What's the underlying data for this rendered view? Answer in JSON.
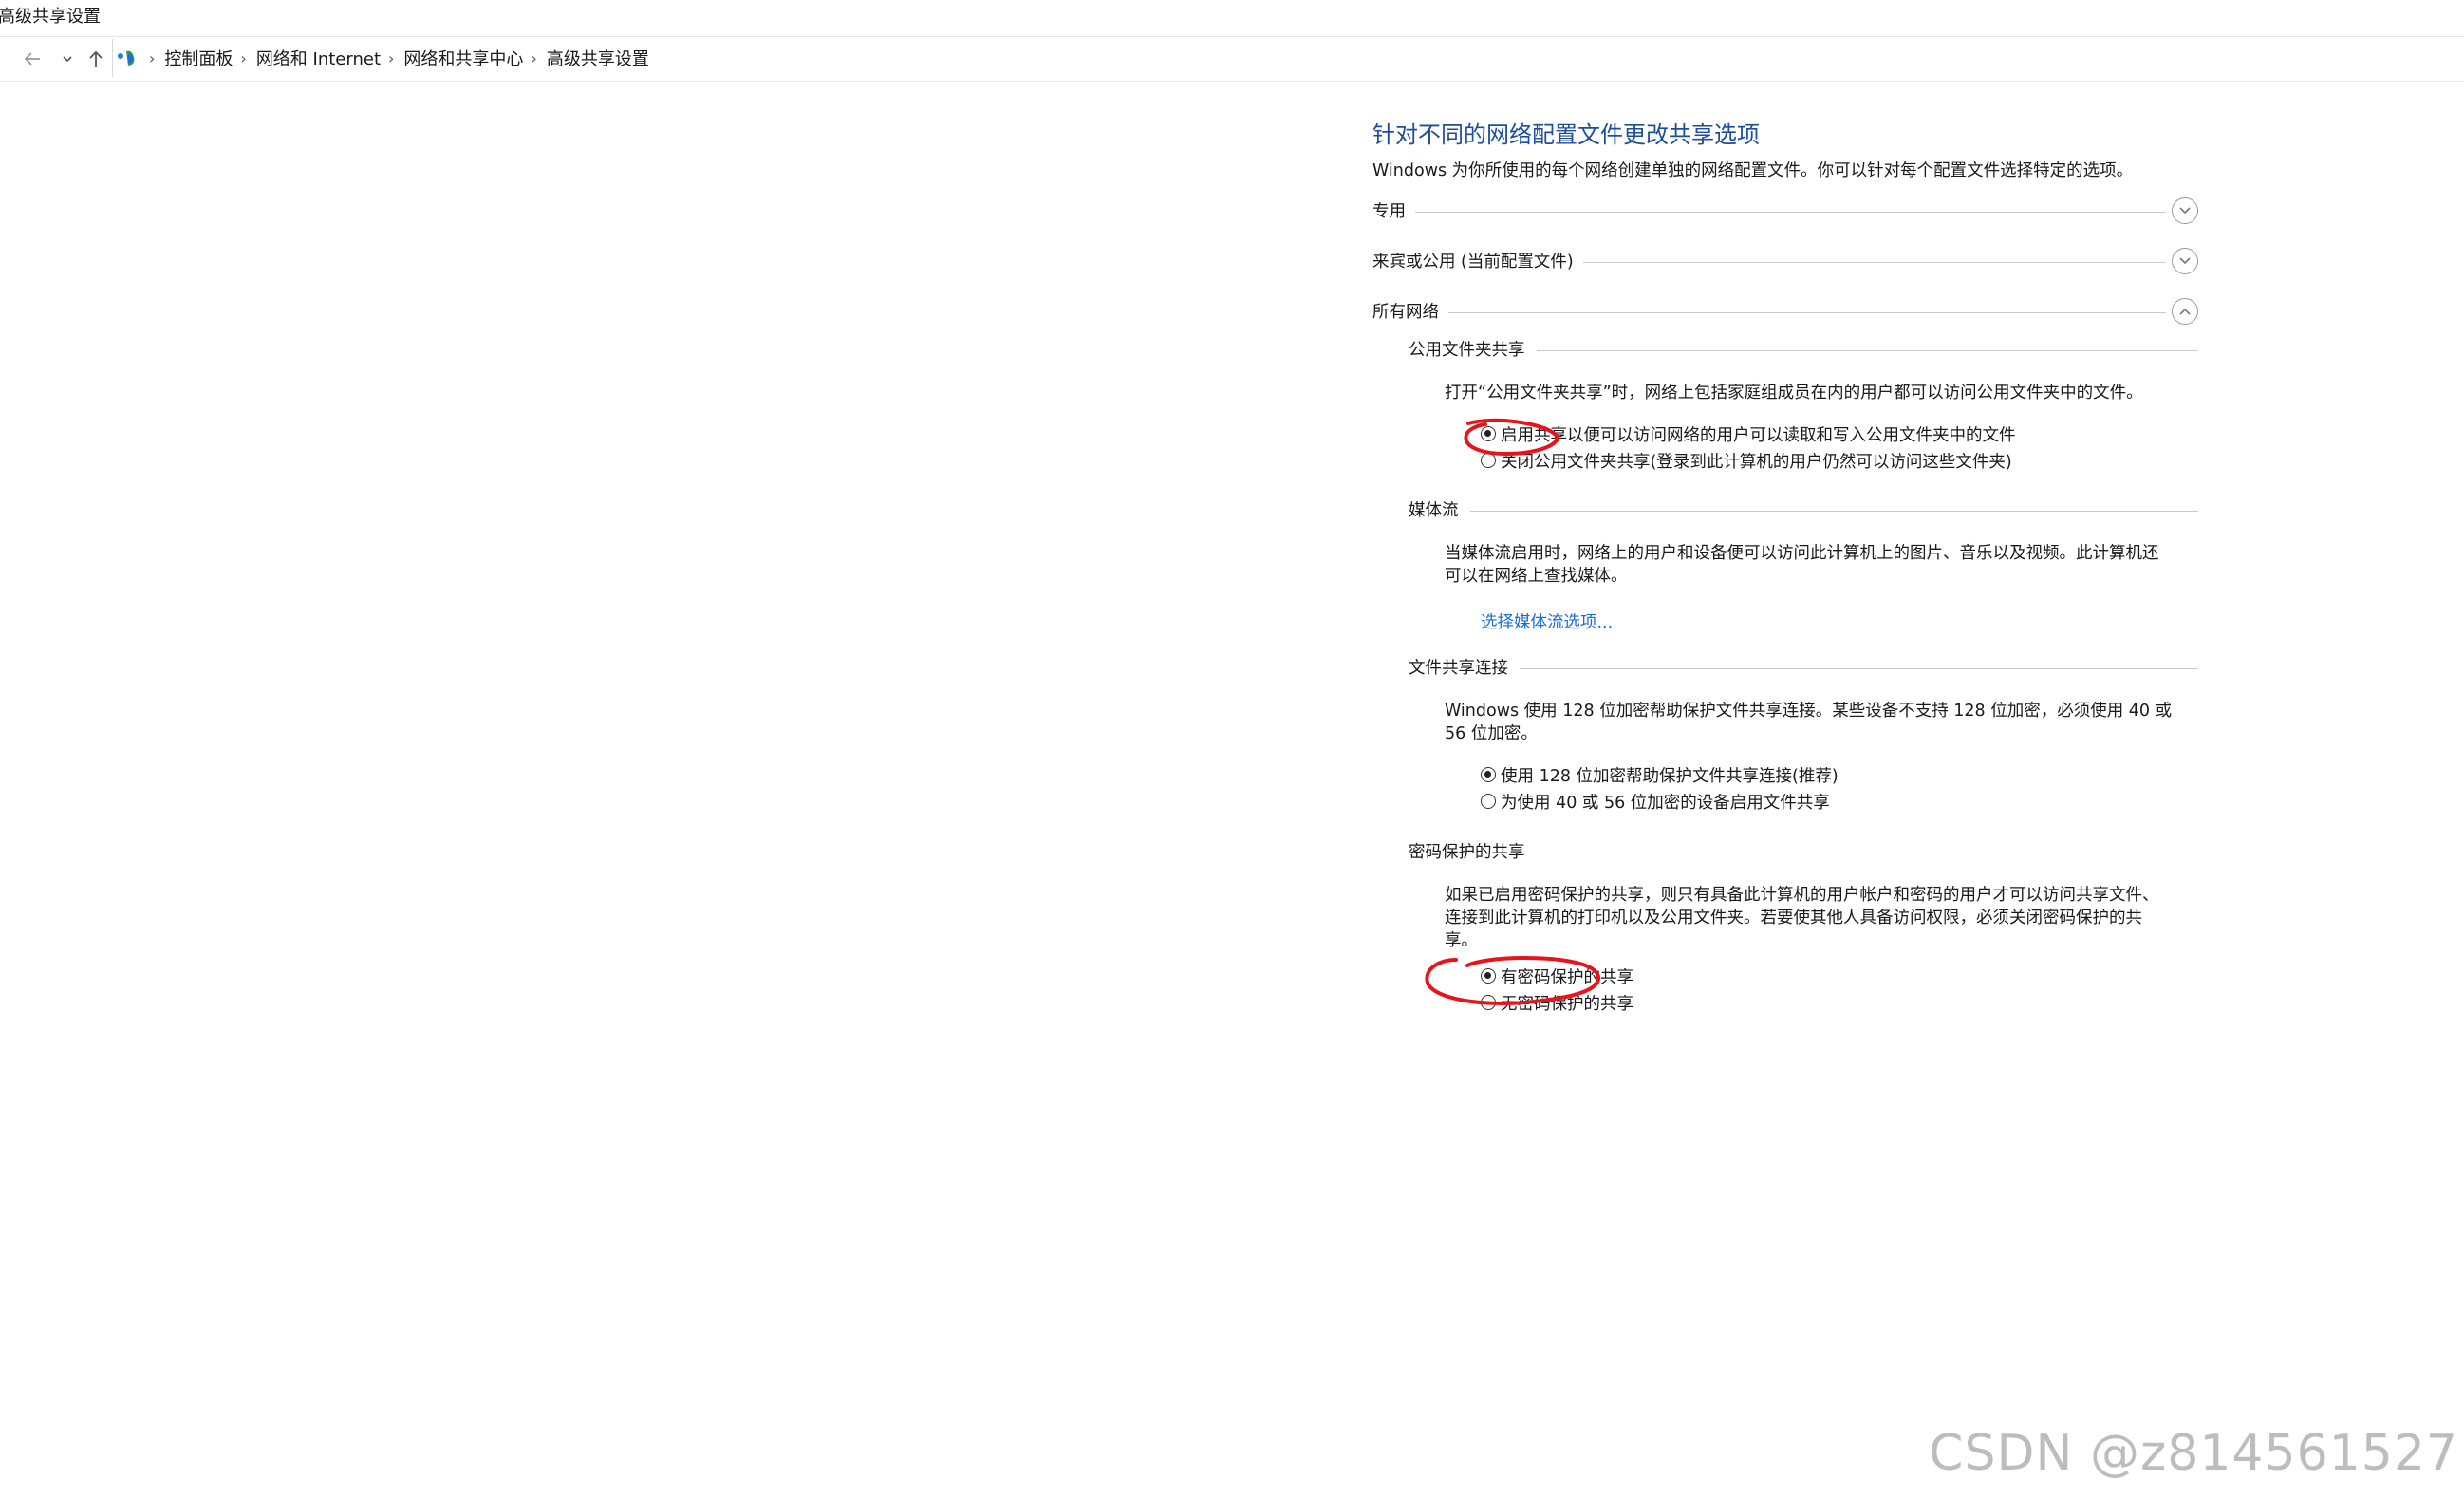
{
  "window": {
    "title": "高级共享设置"
  },
  "address_bar": {
    "back_icon": "arrow-left-icon",
    "recent_icon": "chevron-down-icon",
    "up_icon": "arrow-up-icon",
    "breadcrumbs": [
      "控制面板",
      "网络和 Internet",
      "网络和共享中心",
      "高级共享设置"
    ]
  },
  "main": {
    "heading": "针对不同的网络配置文件更改共享选项",
    "intro": "Windows 为你所使用的每个网络创建单独的网络配置文件。你可以针对每个配置文件选择特定的选项。",
    "profiles": [
      {
        "label": "专用",
        "state": "collapsed"
      },
      {
        "label": "来宾或公用 (当前配置文件)",
        "state": "collapsed"
      },
      {
        "label": "所有网络",
        "state": "expanded"
      }
    ],
    "public_folder": {
      "title": "公用文件夹共享",
      "desc": "打开“公用文件夹共享”时，网络上包括家庭组成员在内的用户都可以访问公用文件夹中的文件。",
      "options": [
        {
          "label": "启用共享以便可以访问网络的用户可以读取和写入公用文件夹中的文件",
          "selected": true
        },
        {
          "label": "关闭公用文件夹共享(登录到此计算机的用户仍然可以访问这些文件夹)",
          "selected": false
        }
      ]
    },
    "media": {
      "title": "媒体流",
      "desc_line1": "当媒体流启用时，网络上的用户和设备便可以访问此计算机上的图片、音乐以及视频。此计算机还",
      "desc_line2": "可以在网络上查找媒体。",
      "link": "选择媒体流选项..."
    },
    "file_sharing": {
      "title": "文件共享连接",
      "desc_line1": "Windows 使用 128 位加密帮助保护文件共享连接。某些设备不支持 128 位加密，必须使用 40 或",
      "desc_line2": "56 位加密。",
      "options": [
        {
          "label": "使用 128 位加密帮助保护文件共享连接(推荐)",
          "selected": true
        },
        {
          "label": "为使用 40 或 56 位加密的设备启用文件共享",
          "selected": false
        }
      ]
    },
    "password": {
      "title": "密码保护的共享",
      "desc_line1": "如果已启用密码保护的共享，则只有具备此计算机的用户帐户和密码的用户才可以访问共享文件、",
      "desc_line2": "连接到此计算机的打印机以及公用文件夹。若要使其他人具备访问权限，必须关闭密码保护的共",
      "desc_line3": "享。",
      "options": [
        {
          "label": "有密码保护的共享",
          "selected": true
        },
        {
          "label": "无密码保护的共享",
          "selected": false
        }
      ]
    }
  },
  "watermark": "CSDN @z814561527",
  "colors": {
    "heading": "#1e4e9a",
    "link": "#1a6fd6",
    "annotation": "#e8141c"
  }
}
